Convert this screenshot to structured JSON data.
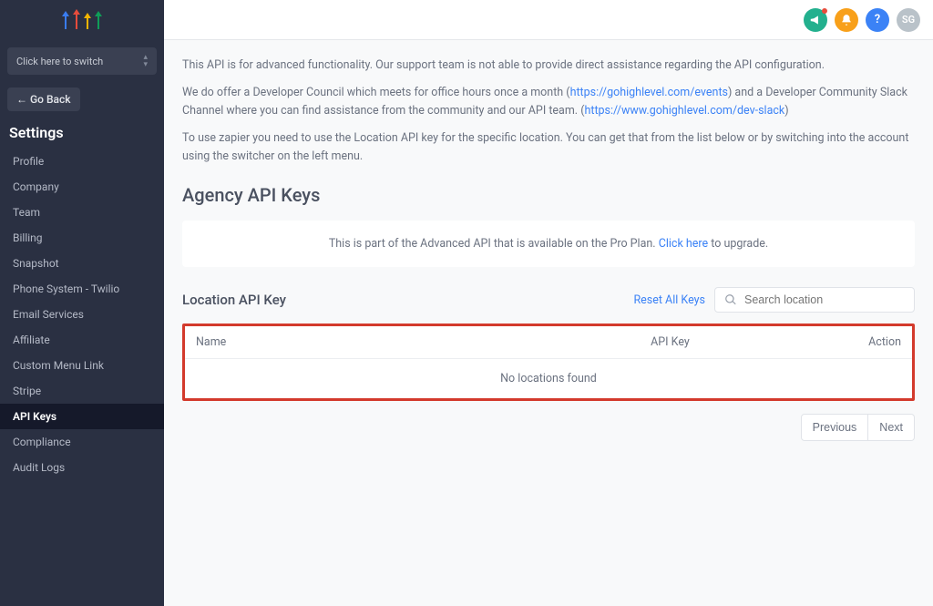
{
  "sidebar": {
    "switch_label": "Click here to switch",
    "go_back": "Go Back",
    "section_title": "Settings",
    "items": [
      {
        "label": "Profile"
      },
      {
        "label": "Company"
      },
      {
        "label": "Team"
      },
      {
        "label": "Billing"
      },
      {
        "label": "Snapshot"
      },
      {
        "label": "Phone System - Twilio"
      },
      {
        "label": "Email Services"
      },
      {
        "label": "Affiliate"
      },
      {
        "label": "Custom Menu Link"
      },
      {
        "label": "Stripe"
      },
      {
        "label": "API Keys"
      },
      {
        "label": "Compliance"
      },
      {
        "label": "Audit Logs"
      }
    ],
    "active_index": 10
  },
  "topbar": {
    "avatar_initials": "SG"
  },
  "intro": {
    "p1_pre": "This API is for advanced functionality. Our support team is not able to provide direct assistance regarding the API configuration.",
    "p2_pre": "We do offer a Developer Council which meets for office hours once a month (",
    "p2_link1": "https://gohighlevel.com/events",
    "p2_mid": ") and a Developer Community Slack Channel where you can find assistance from the community and our API team. (",
    "p2_link2": "https://www.gohighlevel.com/dev-slack",
    "p2_end": ")",
    "p3": "To use zapier you need to use the Location API key for the specific location. You can get that from the list below or by switching into the account using the switcher on the left menu."
  },
  "agency": {
    "heading": "Agency API Keys",
    "upgrade_pre": "This is part of the Advanced API that is available on the Pro Plan. ",
    "upgrade_link": "Click here",
    "upgrade_post": " to upgrade."
  },
  "location": {
    "heading": "Location API Key",
    "reset_label": "Reset All Keys",
    "search_placeholder": "Search location",
    "cols": {
      "name": "Name",
      "key": "API Key",
      "action": "Action"
    },
    "empty": "No locations found",
    "prev": "Previous",
    "next": "Next"
  }
}
